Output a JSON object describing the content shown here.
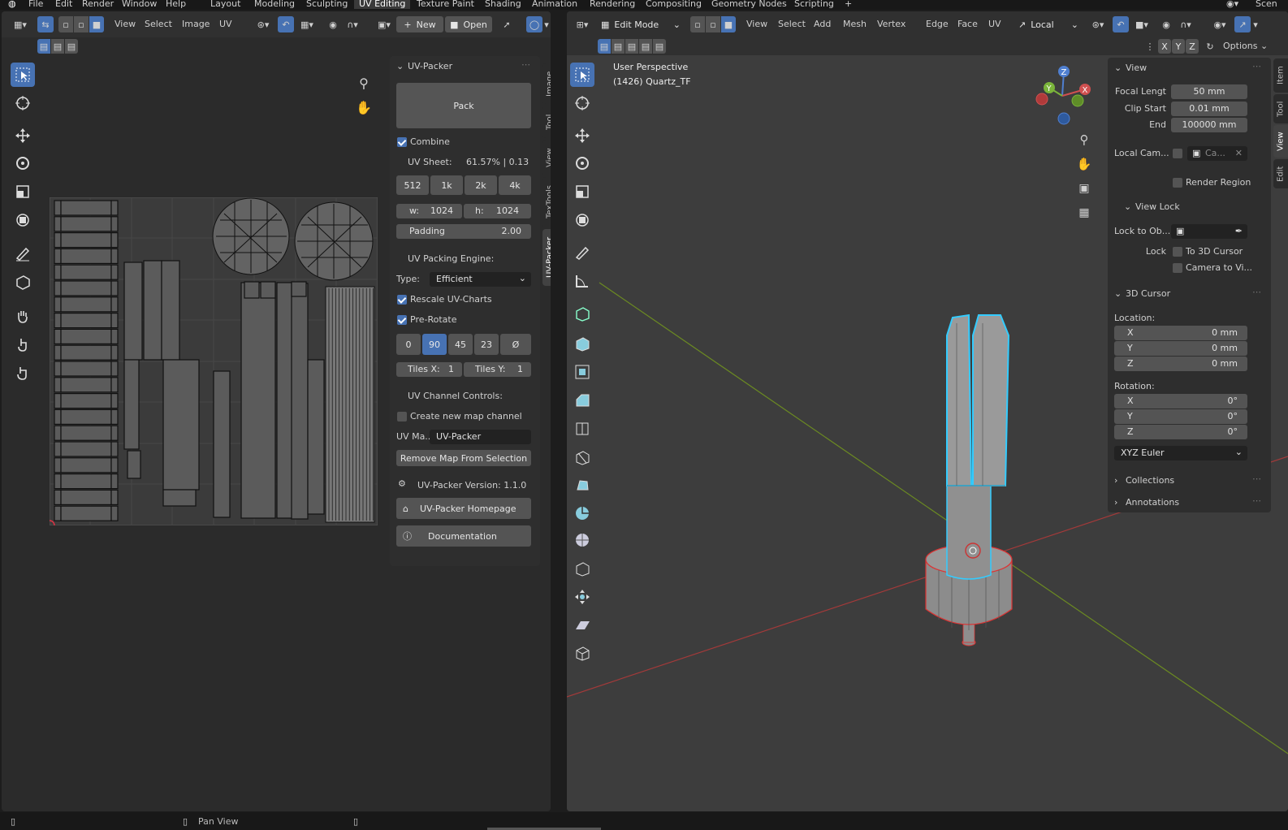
{
  "topbar": {
    "menus": [
      "File",
      "Edit",
      "Render",
      "Window",
      "Help"
    ],
    "workspaces": [
      "Layout",
      "Modeling",
      "Sculpting",
      "UV Editing",
      "Texture Paint",
      "Shading",
      "Animation",
      "Rendering",
      "Compositing",
      "Geometry Nodes",
      "Scripting"
    ],
    "active_workspace": "UV Editing",
    "scene_label": "Scen"
  },
  "uv_editor": {
    "menus": [
      "View",
      "Select",
      "Image",
      "UV"
    ],
    "new_label": "New",
    "open_label": "Open"
  },
  "uvpacker": {
    "title": "UV-Packer",
    "pack_label": "Pack",
    "combine_label": "Combine",
    "combine_checked": true,
    "uv_sheet_label": "UV Sheet:",
    "uv_sheet_value": "61.57% | 0.13",
    "sizes": [
      "512",
      "1k",
      "2k",
      "4k"
    ],
    "w_label": "w:",
    "w_value": "1024",
    "h_label": "h:",
    "h_value": "1024",
    "padding_label": "Padding",
    "padding_value": "2.00",
    "engine_label": "UV Packing Engine:",
    "type_label": "Type:",
    "type_value": "Efficient",
    "rescale_label": "Rescale UV-Charts",
    "prerotate_label": "Pre-Rotate",
    "rotations": [
      "0",
      "90",
      "45",
      "23",
      "Ø"
    ],
    "rotation_active": "90",
    "tiles_x_label": "Tiles X:",
    "tiles_x_value": "1",
    "tiles_y_label": "Tiles Y:",
    "tiles_y_value": "1",
    "channel_label": "UV Channel Controls:",
    "create_map_label": "Create new map channel",
    "uvmap_label": "UV Ma...",
    "uvmap_value": "UV-Packer",
    "remove_map_label": "Remove Map From Selection",
    "version_label": "UV-Packer Version: 1.1.0",
    "homepage_label": "UV-Packer Homepage",
    "docs_label": "Documentation"
  },
  "uv_tabs": [
    "Image",
    "Tool",
    "View",
    "TexTools",
    "UV-Packer"
  ],
  "uv_active_tab": "UV-Packer",
  "viewport": {
    "mode_label": "Edit Mode",
    "menus": [
      "View",
      "Select",
      "Add",
      "Mesh",
      "Vertex",
      "Edge",
      "Face",
      "UV"
    ],
    "orientation": "Local",
    "axes": [
      "X",
      "Y",
      "Z"
    ],
    "options_label": "Options",
    "perspective_label": "User Perspective",
    "object_label": "(1426) Quartz_TF"
  },
  "npanel": {
    "view_title": "View",
    "focal_label": "Focal Lengt",
    "focal_value": "50 mm",
    "clip_start_label": "Clip Start",
    "clip_start_value": "0.01 mm",
    "end_label": "End",
    "end_value": "100000 mm",
    "local_cam_label": "Local Cam...",
    "local_cam_value": "Ca...",
    "render_region_label": "Render Region",
    "view_lock_title": "View Lock",
    "lock_to_obj_label": "Lock to Ob...",
    "lock_label": "Lock",
    "to_cursor_label": "To 3D Cursor",
    "camera_to_view_label": "Camera to Vi...",
    "cursor_title": "3D Cursor",
    "location_label": "Location:",
    "loc": [
      {
        "axis": "X",
        "value": "0 mm"
      },
      {
        "axis": "Y",
        "value": "0 mm"
      },
      {
        "axis": "Z",
        "value": "0 mm"
      }
    ],
    "rotation_label": "Rotation:",
    "rot": [
      {
        "axis": "X",
        "value": "0°"
      },
      {
        "axis": "Y",
        "value": "0°"
      },
      {
        "axis": "Z",
        "value": "0°"
      }
    ],
    "rotation_mode": "XYZ Euler",
    "collections_label": "Collections",
    "annotations_label": "Annotations"
  },
  "npanel_tabs": [
    "Item",
    "Tool",
    "View",
    "Edit"
  ],
  "npanel_active_tab": "View",
  "status": {
    "pan_label": "Pan View"
  }
}
